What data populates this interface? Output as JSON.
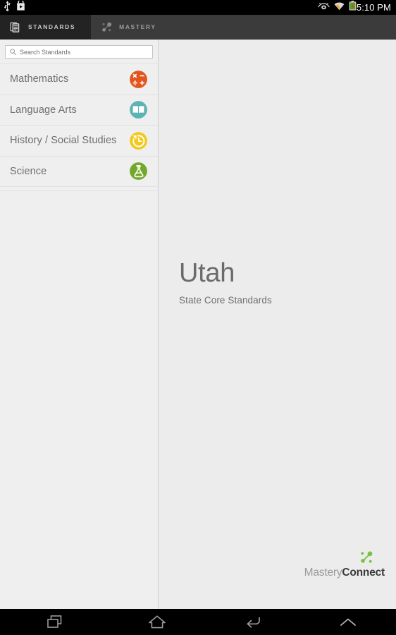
{
  "statusbar": {
    "time": "5:10 PM",
    "left_icons": [
      {
        "name": "usb-icon",
        "label": "USB"
      },
      {
        "name": "play-store-icon",
        "label": "Play Store"
      }
    ],
    "right_icons": [
      {
        "name": "eye-icon",
        "label": "Smart stay"
      },
      {
        "name": "wifi-icon",
        "label": "Wi-Fi"
      },
      {
        "name": "battery-charging-icon",
        "label": "Battery charging"
      }
    ]
  },
  "tabs": [
    {
      "label": "STANDARDS",
      "icon": "documents-icon",
      "active": true
    },
    {
      "label": "MASTERY",
      "icon": "nodes-icon",
      "active": false
    }
  ],
  "search": {
    "placeholder": "Search Standards",
    "value": "",
    "icon": "search-icon"
  },
  "subjects": [
    {
      "label": "Mathematics",
      "icon": "math-operators-icon",
      "color": "#e2561e"
    },
    {
      "label": "Language Arts",
      "icon": "open-book-icon",
      "color": "#5cb3b3"
    },
    {
      "label": "History / Social Studies",
      "icon": "clock-history-icon",
      "color": "#f2c91a"
    },
    {
      "label": "Science",
      "icon": "flask-icon",
      "color": "#74a82c"
    }
  ],
  "content": {
    "state_title": "Utah",
    "state_subtitle": "State Core Standards"
  },
  "brand": {
    "name_light": "Mastery",
    "name_bold": "Connect",
    "mark_icon": "masteryconnect-nodes-icon",
    "mark_color": "#7ac143"
  },
  "navbar": [
    {
      "name": "recents-button",
      "icon": "recents-icon"
    },
    {
      "name": "home-button",
      "icon": "home-icon"
    },
    {
      "name": "back-button",
      "icon": "back-icon"
    },
    {
      "name": "expand-button",
      "icon": "chevron-up-icon"
    }
  ],
  "colors": {
    "actionbar_bg": "#3b3b3b",
    "active_tab_bg": "#232323",
    "sidebar_bg": "#efefef",
    "content_bg": "#ececec",
    "text_muted": "#6e6e6e"
  }
}
